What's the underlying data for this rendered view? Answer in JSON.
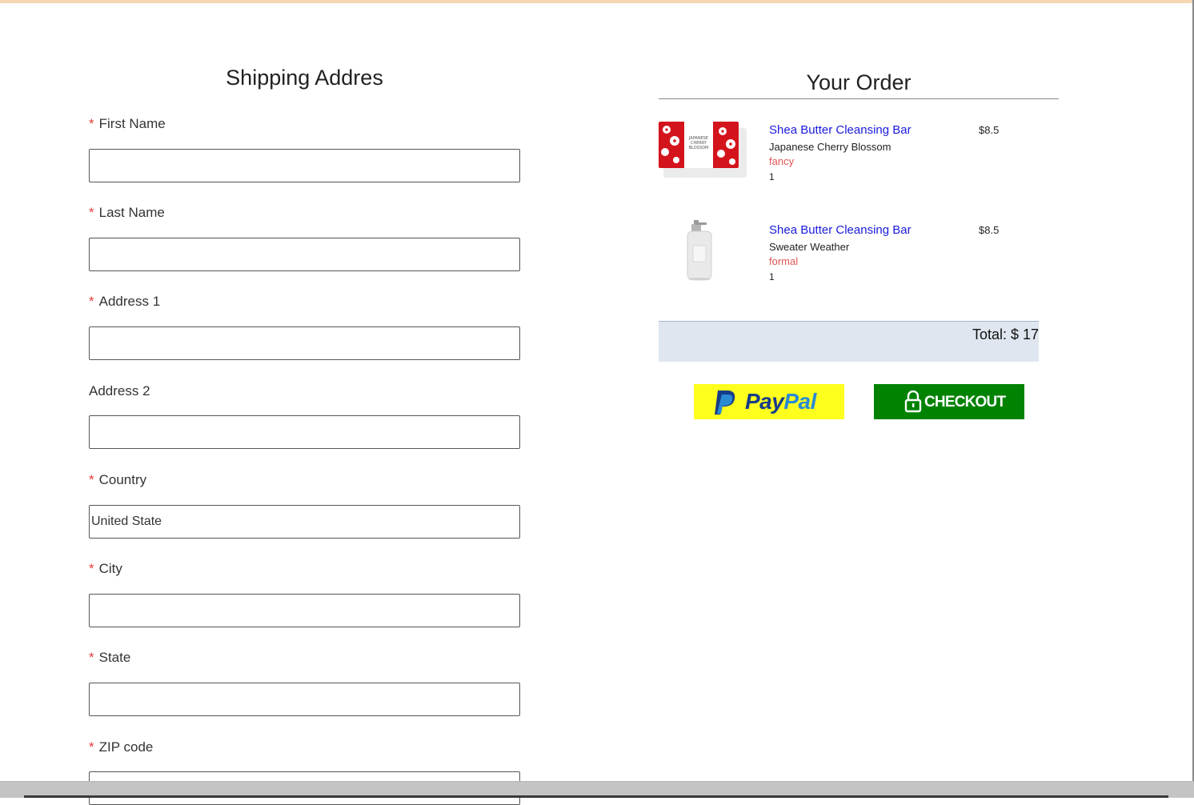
{
  "shipping": {
    "title": "Shipping Addres",
    "fields": {
      "first_name": {
        "label": "First Name",
        "required_mark": "*",
        "value": ""
      },
      "last_name": {
        "label": "Last Name",
        "required_mark": "*",
        "value": ""
      },
      "address1": {
        "label": "Address 1",
        "required_mark": "*",
        "value": ""
      },
      "address2": {
        "label": "Address 2",
        "value": ""
      },
      "country": {
        "label": "Country",
        "required_mark": "*",
        "value": "United State"
      },
      "city": {
        "label": "City",
        "required_mark": "*",
        "value": ""
      },
      "state": {
        "label": "State",
        "required_mark": "*",
        "value": ""
      },
      "zip": {
        "label": "ZIP code",
        "required_mark": "*",
        "value": ""
      }
    }
  },
  "order": {
    "title": "Your Order",
    "items": [
      {
        "name": "Shea Butter Cleansing Bar",
        "variant": "Japanese Cherry Blossom",
        "style": "fancy",
        "quantity": "1",
        "price": "$8.5",
        "image_icon": "soap-bar-image",
        "package_text": "JAPANESE CHERRY BLOSSOM"
      },
      {
        "name": "Shea Butter Cleansing Bar",
        "variant": "Sweater Weather",
        "style": "formal",
        "quantity": "1",
        "price": "$8.5",
        "image_icon": "soap-pump-bottle-image"
      }
    ],
    "total_label": "Total: $ 17"
  },
  "actions": {
    "paypal": {
      "pay": "Pay",
      "pal": "Pal",
      "icon": "paypal-logo-icon",
      "color": "#ffff1e"
    },
    "checkout": {
      "label": "CHECKOUT",
      "icon": "lock-icon",
      "color": "#028203"
    }
  },
  "colors": {
    "link": "#1a1adb",
    "required": "#e23b3b",
    "style_text": "#e25555",
    "total_bg": "#dfe6ef"
  }
}
